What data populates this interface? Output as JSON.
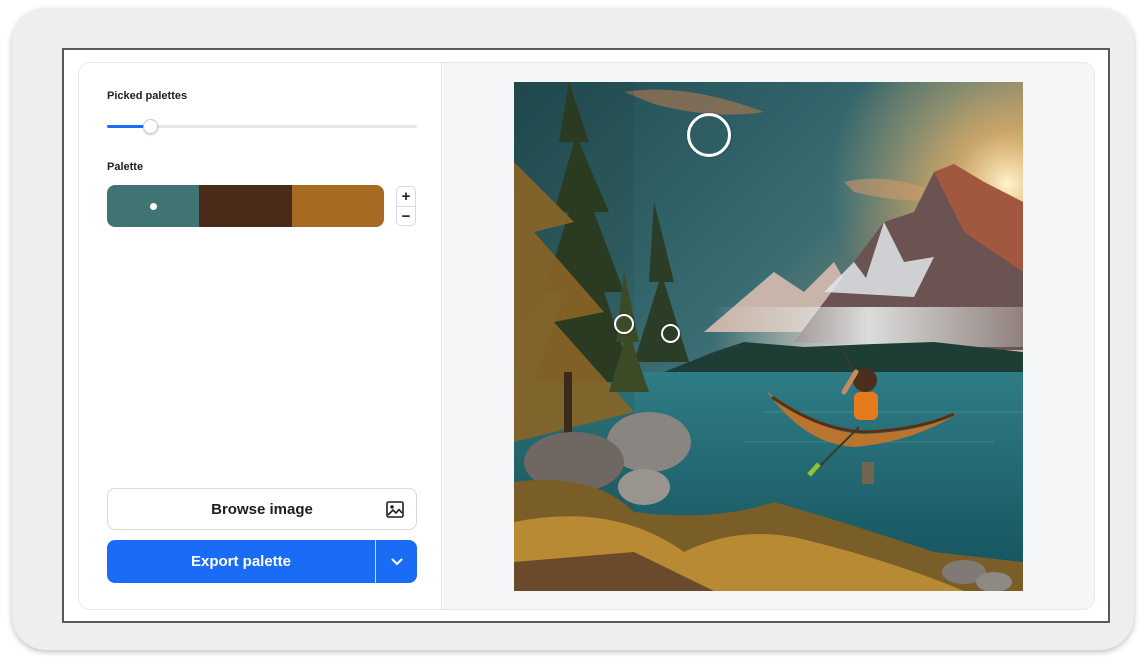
{
  "sidebar": {
    "picked_palettes_label": "Picked palettes",
    "slider": {
      "value_fraction": 0.14
    },
    "palette_label": "Palette",
    "palette": [
      {
        "color": "#3f7473",
        "selected": true
      },
      {
        "color": "#4a2a18",
        "selected": false
      },
      {
        "color": "#a66a22",
        "selected": false
      }
    ],
    "stepper": {
      "increment_label": "+",
      "decrement_label": "−"
    },
    "browse_button": {
      "label": "Browse image",
      "icon": "image-icon"
    },
    "export_button": {
      "label": "Export palette",
      "dropdown_icon": "chevron-down-icon"
    }
  },
  "preview": {
    "image_subject": "kayaker on mountain lake at sunset",
    "picker_icons": [
      "picker-ring-icon"
    ]
  },
  "colors": {
    "accent": "#1a6cf6",
    "sidebar_bg": "#ffffff",
    "preview_bg": "#f5f6f8"
  }
}
